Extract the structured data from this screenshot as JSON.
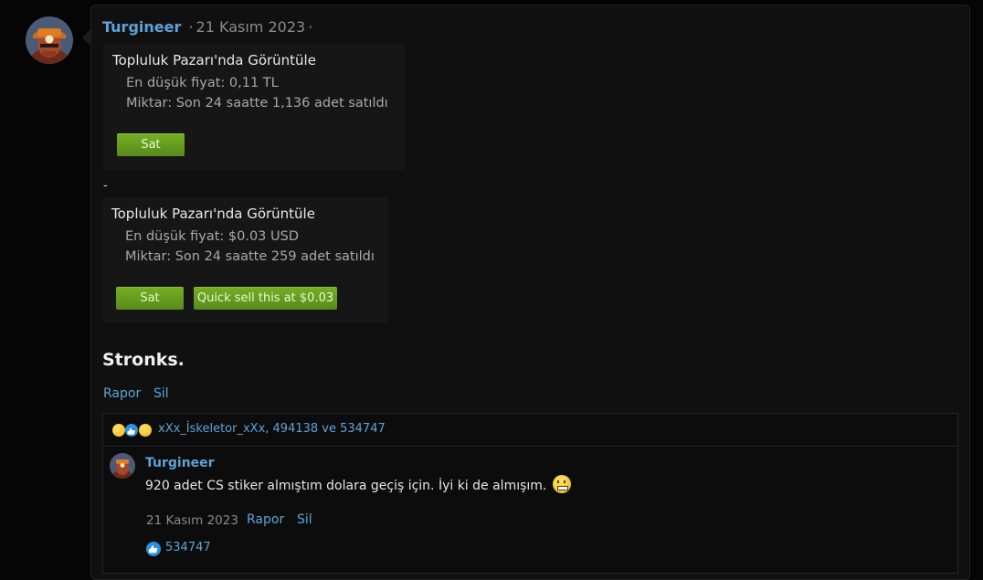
{
  "post": {
    "author": "Turgineer",
    "date": "21 Kasım 2023",
    "sep1": "·",
    "sep2": "·"
  },
  "market_cards": [
    {
      "title": "Topluluk Pazarı'nda Görüntüle",
      "price_line": "En düşük fiyat: 0,11 TL",
      "qty_line": "Miktar: Son 24 saatte 1,136 adet satıldı",
      "sell_label": "Sat"
    },
    {
      "title": "Topluluk Pazarı'nda Görüntüle",
      "price_line": "En düşük fiyat: $0.03 USD",
      "qty_line": "Miktar: Son 24 saatte 259 adet satıldı",
      "sell_label": "Sat",
      "quick_sell_label": "Quick sell this at $0.03"
    }
  ],
  "separator_text": "-",
  "body_text": "Stronks.",
  "actions": {
    "report": "Rapor",
    "delete": "Sil"
  },
  "reactions": {
    "users": "xXx_İskeletor_xXx, 494138 ve 534747",
    "icons": [
      "thinking-face-icon",
      "like-icon",
      "flushed-face-icon"
    ]
  },
  "reply": {
    "author": "Turgineer",
    "text": "920 adet CS stiker almıştım dolara geçiş için. İyi ki de almışım.",
    "date": "21 Kasım 2023",
    "report": "Rapor",
    "delete": "Sil",
    "like_user": "534747"
  },
  "colors": {
    "link": "#5ea3d8",
    "button_green": "#6aa11f",
    "background": "#101010"
  }
}
